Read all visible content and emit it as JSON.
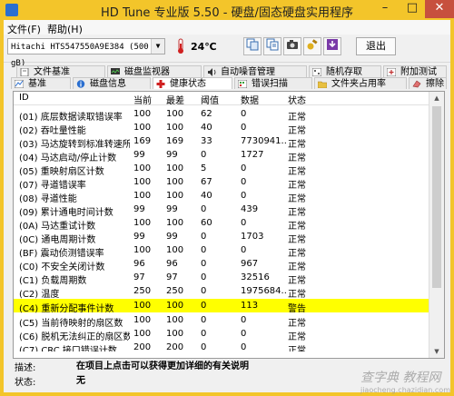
{
  "window": {
    "title": "HD Tune 专业版 5.50 - 硬盘/固态硬盘实用程序",
    "controls": {
      "minimize": "–",
      "maximize": "□",
      "close": "✕"
    }
  },
  "menu": {
    "file": "文件(F)",
    "help": "帮助(H)"
  },
  "toolbar": {
    "drive": "Hitachi HTS547550A9E384 (500 gB)",
    "temperature": "24℃",
    "exit_label": "退出"
  },
  "tabs": {
    "row1": [
      {
        "label": "文件基准",
        "icon": "file-icon"
      },
      {
        "label": "磁盘监视器",
        "icon": "monitor-icon"
      },
      {
        "label": "自动噪音管理",
        "icon": "speaker-icon"
      },
      {
        "label": "随机存取",
        "icon": "random-icon"
      },
      {
        "label": "附加测试",
        "icon": "plus-icon"
      }
    ],
    "row2": [
      {
        "label": "基准",
        "icon": "chart-icon"
      },
      {
        "label": "磁盘信息",
        "icon": "info-icon"
      },
      {
        "label": "健康状态",
        "icon": "health-icon"
      },
      {
        "label": "错误扫描",
        "icon": "scan-icon"
      },
      {
        "label": "文件夹占用率",
        "icon": "folder-icon"
      },
      {
        "label": "擦除",
        "icon": "erase-icon"
      }
    ],
    "active": "健康状态"
  },
  "table": {
    "headers": [
      "ID",
      "当前",
      "最差",
      "阈值",
      "数据",
      "状态"
    ],
    "rows": [
      [
        "(01) 底层数据读取错误率",
        "100",
        "100",
        "62",
        "0",
        "正常"
      ],
      [
        "(02) 吞吐量性能",
        "100",
        "100",
        "40",
        "0",
        "正常"
      ],
      [
        "(03) 马达旋转到标准转速所...",
        "169",
        "169",
        "33",
        "7730941...",
        "正常"
      ],
      [
        "(04) 马达启动/停止计数",
        "99",
        "99",
        "0",
        "1727",
        "正常"
      ],
      [
        "(05) 重映射扇区计数",
        "100",
        "100",
        "5",
        "0",
        "正常"
      ],
      [
        "(07) 寻道错误率",
        "100",
        "100",
        "67",
        "0",
        "正常"
      ],
      [
        "(08) 寻道性能",
        "100",
        "100",
        "40",
        "0",
        "正常"
      ],
      [
        "(09) 累计通电时间计数",
        "99",
        "99",
        "0",
        "439",
        "正常"
      ],
      [
        "(0A) 马达重试计数",
        "100",
        "100",
        "60",
        "0",
        "正常"
      ],
      [
        "(0C) 通电周期计数",
        "99",
        "99",
        "0",
        "1703",
        "正常"
      ],
      [
        "(BF) 震动侦测错误率",
        "100",
        "100",
        "0",
        "0",
        "正常"
      ],
      [
        "(C0) 不安全关闭计数",
        "96",
        "96",
        "0",
        "967",
        "正常"
      ],
      [
        "(C1) 负载周期数",
        "97",
        "97",
        "0",
        "32516",
        "正常"
      ],
      [
        "(C2) 温度",
        "250",
        "250",
        "0",
        "1975684...",
        "正常"
      ],
      [
        "(C4) 重新分配事件计数",
        "100",
        "100",
        "0",
        "113",
        "警告"
      ],
      [
        "(C5) 当前待映射的扇区数",
        "100",
        "100",
        "0",
        "0",
        "正常"
      ],
      [
        "(C6) 脱机无法纠正的扇区数",
        "100",
        "100",
        "0",
        "0",
        "正常"
      ],
      [
        "(C7) CRC 接口错误计数",
        "200",
        "200",
        "0",
        "0",
        "正常"
      ]
    ],
    "highlight_row": 14,
    "highlight_color": "#ffff00"
  },
  "footer": {
    "desc_label": "描述:",
    "desc_value": "在项目上点击可以获得更加详细的有关说明",
    "status_label": "状态:",
    "status_value": "无"
  },
  "watermark": {
    "text": "查字典 教程网",
    "url": "jiaocheng.chazidian.com"
  },
  "colors": {
    "titlebar": "#f3c52a",
    "close": "#c7503e"
  }
}
